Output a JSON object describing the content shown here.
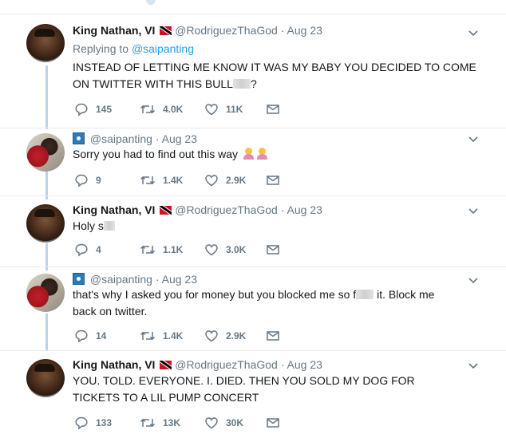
{
  "tweets": [
    {
      "name": "King Nathan, VI",
      "handle": "@RodriguezThaGod",
      "sep": "·",
      "date": "Aug 23",
      "replying_prefix": "Replying to",
      "replying_handle": "@saipanting",
      "text_a": "INSTEAD OF LETTING ME KNOW IT WAS MY BABY YOU DECIDED TO COME ON TWITTER WITH THIS BULL",
      "text_b": "?",
      "replies": "145",
      "retweets": "4.0K",
      "likes": "11K"
    },
    {
      "handle": "@saipanting",
      "sep": "·",
      "date": "Aug 23",
      "text_a": "Sorry you had to find out this way",
      "emojis": [
        "woman-shrugging-emoji",
        "woman-shrugging-emoji"
      ],
      "replies": "9",
      "retweets": "1.4K",
      "likes": "2.9K"
    },
    {
      "name": "King Nathan, VI",
      "handle": "@RodriguezThaGod",
      "sep": "·",
      "date": "Aug 23",
      "text_a": "Holy s",
      "replies": "4",
      "retweets": "1.1K",
      "likes": "3.0K"
    },
    {
      "handle": "@saipanting",
      "sep": "·",
      "date": "Aug 23",
      "text_a": "that's why I asked you for money but you blocked me so f",
      "text_b": " it. Block me back on twitter.",
      "replies": "14",
      "retweets": "1.4K",
      "likes": "2.9K"
    },
    {
      "name": "King Nathan, VI",
      "handle": "@RodriguezThaGod",
      "sep": "·",
      "date": "Aug 23",
      "text_a": "YOU. TOLD. EVERYONE. I. DIED. THEN YOU SOLD MY DOG FOR TICKETS TO A LIL PUMP CONCERT",
      "replies": "133",
      "retweets": "13K",
      "likes": "30K"
    }
  ],
  "colors": {
    "text": "#14171a",
    "meta": "#657786",
    "link": "#1da1f2",
    "thread_line": "#b9d4e9",
    "divider": "#e6ecf0"
  },
  "icons": [
    "reply-icon",
    "retweet-icon",
    "like-icon",
    "direct-message-icon",
    "chevron-down-icon",
    "trinidad-flag-icon",
    "profile-badge-icon"
  ]
}
